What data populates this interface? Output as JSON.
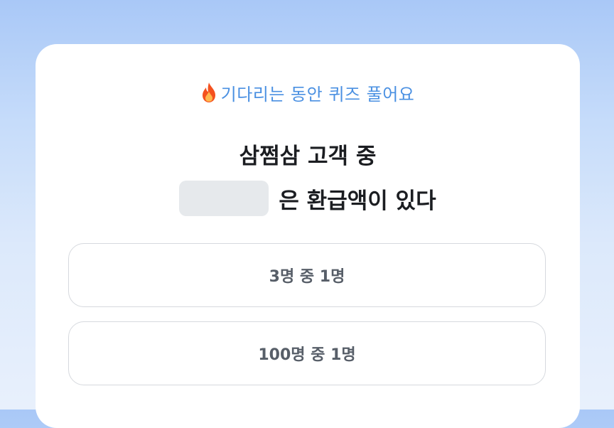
{
  "quiz": {
    "subtitle_icon": "fire-icon",
    "subtitle": "기다리는 동안 퀴즈 풀어요",
    "question_line1": "삼쩜삼 고객 중",
    "question_line2_rest": "은 환급액이 있다",
    "options": [
      {
        "label": "3명 중 1명"
      },
      {
        "label": "100명 중 1명"
      }
    ]
  },
  "colors": {
    "accent": "#4a90e2",
    "question_text": "#1b1d21",
    "option_text": "#575e68",
    "blank_fill": "#e6e9ec",
    "fire": "#f4511e"
  }
}
